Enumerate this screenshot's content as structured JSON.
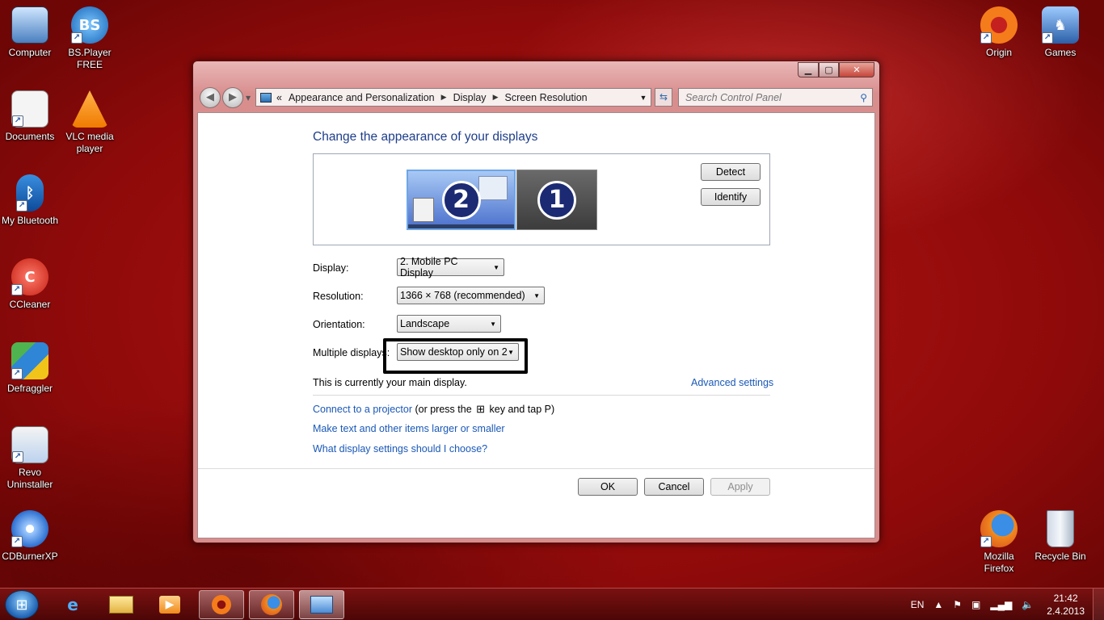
{
  "desktop": {
    "left_icons": [
      {
        "label": "Computer",
        "icon": "computer-icon"
      },
      {
        "label": "BS.Player FREE",
        "icon": "bsplayer-icon"
      },
      {
        "label": "Documents",
        "icon": "documents-icon"
      },
      {
        "label": "VLC media player",
        "icon": "vlc-icon"
      },
      {
        "label": "My Bluetooth",
        "icon": "bluetooth-icon"
      },
      {
        "label": "CCleaner",
        "icon": "ccleaner-icon"
      },
      {
        "label": "Defraggler",
        "icon": "defraggler-icon"
      },
      {
        "label": "Revo Uninstaller",
        "icon": "revo-icon"
      },
      {
        "label": "CDBurnerXP",
        "icon": "cdburner-icon"
      }
    ],
    "right_icons": [
      {
        "label": "Origin",
        "icon": "origin-icon"
      },
      {
        "label": "Games",
        "icon": "games-icon"
      },
      {
        "label": "Mozilla Firefox",
        "icon": "firefox-icon"
      },
      {
        "label": "Recycle Bin",
        "icon": "recycle-bin-icon"
      }
    ]
  },
  "window": {
    "breadcrumb": {
      "overflow": "«",
      "items": [
        "Appearance and Personalization",
        "Display",
        "Screen Resolution"
      ]
    },
    "search_placeholder": "Search Control Panel",
    "title": "Change the appearance of your displays",
    "monitors": [
      {
        "number": "2",
        "selected": true
      },
      {
        "number": "1",
        "selected": false
      }
    ],
    "detect_label": "Detect",
    "identify_label": "Identify",
    "display": {
      "label": "Display:",
      "value": "2. Mobile PC Display"
    },
    "resolution": {
      "label": "Resolution:",
      "value": "1366 × 768 (recommended)"
    },
    "orientation": {
      "label": "Orientation:",
      "value": "Landscape"
    },
    "multiple": {
      "label": "Multiple displays:",
      "value": "Show desktop only on 2"
    },
    "main_display_text": "This is currently your main display.",
    "advanced_settings": "Advanced settings",
    "projector_link": "Connect to a projector",
    "projector_hint_1": "(or press the",
    "projector_hint_2": "key and tap P)",
    "text_size_link": "Make text and other items larger or smaller",
    "help_link": "What display settings should I choose?",
    "ok_label": "OK",
    "cancel_label": "Cancel",
    "apply_label": "Apply"
  },
  "taskbar": {
    "language": "EN",
    "time": "21:42",
    "date": "2.4.2013",
    "pinned": [
      "internet-explorer-icon",
      "explorer-icon",
      "media-player-icon",
      "origin-icon",
      "firefox-icon",
      "control-panel-icon"
    ]
  },
  "colors": {
    "desktop_red": "#a20f0f",
    "link_blue": "#1a58b7",
    "title_blue": "#1e3e8a"
  }
}
